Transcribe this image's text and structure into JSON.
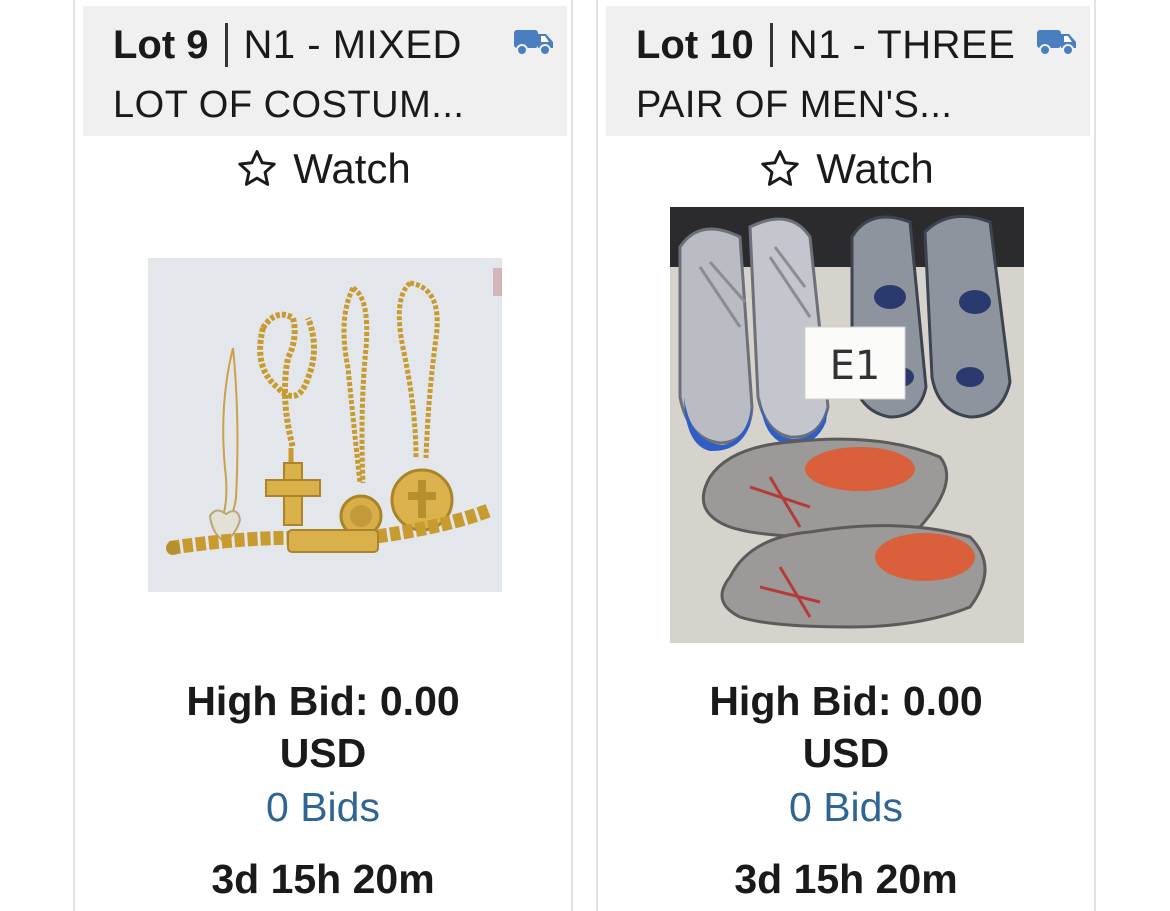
{
  "lots": [
    {
      "lot_label": "Lot 9",
      "category": "N1 - MIXED",
      "title": "LOT OF COSTUM...",
      "watch_label": "Watch",
      "high_bid": "High Bid: 0.00",
      "currency": "USD",
      "bids": "0 Bids",
      "time_left": "3d 15h 20m",
      "photo": "gold-jewelry-photo"
    },
    {
      "lot_label": "Lot 10",
      "category": "N1 - THREE",
      "title": "PAIR OF MEN'S...",
      "watch_label": "Watch",
      "high_bid": "High Bid: 0.00",
      "currency": "USD",
      "bids": "0 Bids",
      "time_left": "3d 15h 20m",
      "photo": "sneakers-photo",
      "photo_tag": "E1"
    }
  ],
  "colors": {
    "accent_link": "#2f6594",
    "shipping_icon": "#4a7fbf",
    "header_bg": "#f0f0f0"
  },
  "icons": [
    "shipping-truck-icon",
    "star-outline-icon"
  ]
}
